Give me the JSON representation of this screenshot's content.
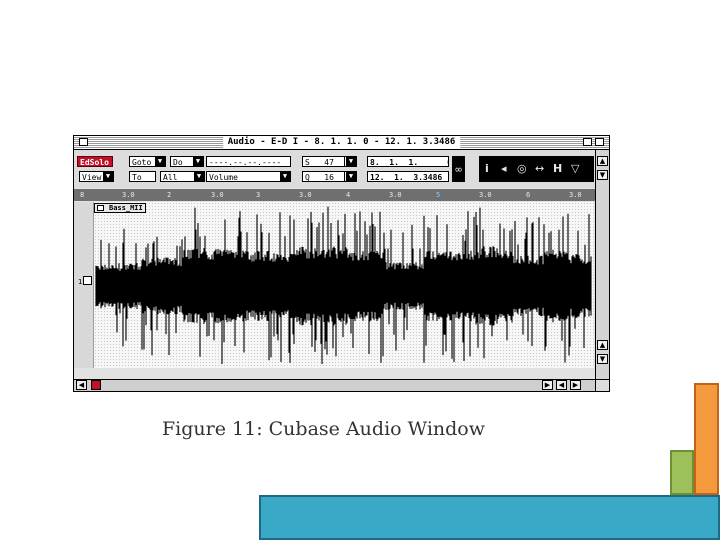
{
  "window": {
    "title": "Audio - E-D I -    8. 1. 1.   0 -   12. 1. 3.3486"
  },
  "toolbar": {
    "solo_label": "EdSolo",
    "view_label": "View",
    "goto_label": "Goto",
    "do_label": "Do",
    "to_label": "To",
    "all_label": "All",
    "time_field": "----.--.--.----",
    "volume_label": "Volume",
    "s_label": "S",
    "s_value": "47",
    "q_label": "Q",
    "q_value": "16",
    "start_position": "8.  1.  1.      0",
    "end_position": "12.  1.  3.3486",
    "link_icon": "chain-link-icon",
    "panel_icons": [
      "info-icon",
      "speaker-icon",
      "scrub-icon",
      "move-icon",
      "resize-icon",
      "mute-icon"
    ]
  },
  "ruler": {
    "labels": [
      "8",
      "3.0",
      "2",
      "3.0",
      "3",
      "3.0",
      "4",
      "3.0",
      "5",
      "3.0",
      "6",
      "3.0"
    ]
  },
  "track": {
    "event_name": "Bass_MII",
    "track_number": "1"
  },
  "caption": {
    "text": "Figure 11: Cubase Audio Window"
  },
  "colors": {
    "solo_button": "#c0102a",
    "panel_background": "#000000",
    "ruler_background": "#6f6f6f",
    "orange_bar": "#f29a3c",
    "green_bar": "#9ec05a",
    "blue_bar": "#3aa9c7"
  }
}
